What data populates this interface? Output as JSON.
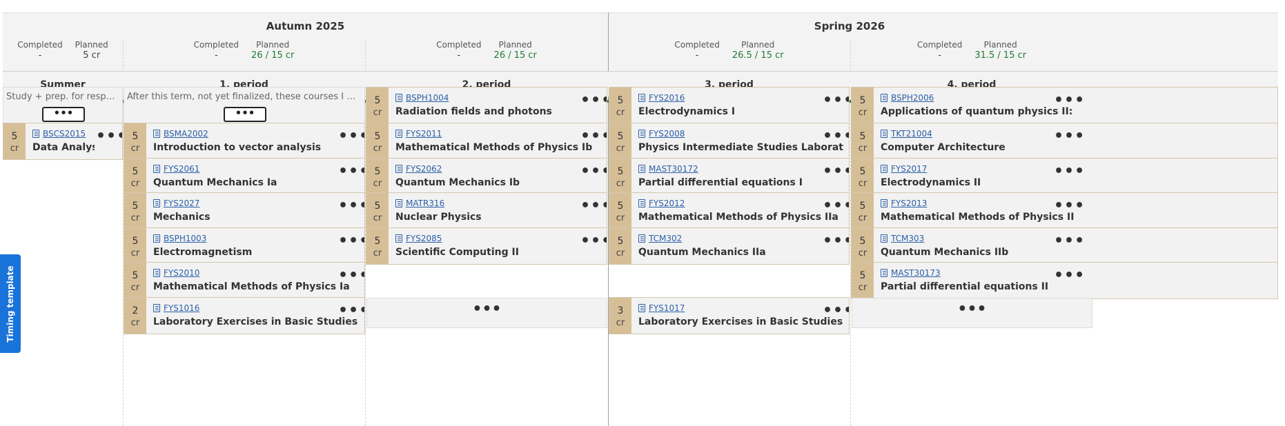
{
  "terms": {
    "autumn": {
      "title": "Autumn 2025"
    },
    "spring": {
      "title": "Spring 2026"
    }
  },
  "stats_labels": {
    "completed": "Completed",
    "planned": "Planned"
  },
  "periods": {
    "summer": {
      "title": "Summer",
      "completed": "-",
      "planned": "5 cr"
    },
    "p1": {
      "title": "1. period",
      "completed": "-",
      "planned": "26 / 15 cr"
    },
    "p2": {
      "title": "2. period",
      "completed": "-",
      "planned": "26 / 15 cr"
    },
    "p3": {
      "title": "3. period",
      "completed": "-",
      "planned": "26.5 / 15 cr"
    },
    "p4": {
      "title": "4. period",
      "completed": "-",
      "planned": "31.5 / 15 cr"
    }
  },
  "notes": {
    "summer": "Study + prep. for respective e...",
    "p1": "After this term, not yet finalized, these courses I would really lik...",
    "menu_label": "•••"
  },
  "credit_unit": "cr",
  "menu_label": "•••",
  "courses": {
    "summer": [
      {
        "credits": "5",
        "code": "BSCS2015",
        "name": "Data Analysis wit"
      }
    ],
    "p1": [
      {
        "credits": "5",
        "code": "BSMA2002",
        "name": "Introduction to vector analysis"
      },
      {
        "credits": "5",
        "code": "FYS2061",
        "name": "Quantum Mechanics Ia"
      },
      {
        "credits": "5",
        "code": "FYS2027",
        "name": "Mechanics"
      },
      {
        "credits": "5",
        "code": "BSPH1003",
        "name": "Electromagnetism"
      },
      {
        "credits": "5",
        "code": "FYS2010",
        "name": "Mathematical Methods of Physics Ia"
      },
      {
        "credits": "2",
        "code": "FYS1016",
        "name": "Laboratory Exercises in Basic Studies of Physics I"
      }
    ],
    "p2": [
      {
        "credits": "5",
        "code": "BSPH1004",
        "name": "Radiation fields and photons"
      },
      {
        "credits": "5",
        "code": "FYS2011",
        "name": "Mathematical Methods of Physics Ib"
      },
      {
        "credits": "5",
        "code": "FYS2062",
        "name": "Quantum Mechanics Ib"
      },
      {
        "credits": "5",
        "code": "MATR316",
        "name": "Nuclear Physics"
      },
      {
        "credits": "5",
        "code": "FYS2085",
        "name": "Scientific Computing II"
      }
    ],
    "p3": [
      {
        "credits": "5",
        "code": "FYS2016",
        "name": "Electrodynamics I"
      },
      {
        "credits": "5",
        "code": "FYS2008",
        "name": "Physics Intermediate Studies Laboratory Exercises"
      },
      {
        "credits": "5",
        "code": "MAST30172",
        "name": "Partial differential equations I"
      },
      {
        "credits": "5",
        "code": "FYS2012",
        "name": "Mathematical Methods of Physics IIa"
      },
      {
        "credits": "5",
        "code": "TCM302",
        "name": "Quantum Mechanics IIa"
      },
      {
        "credits": "3",
        "code": "FYS1017",
        "name": "Laboratory Exercises in Basic Studies of Physics II"
      }
    ],
    "p4": [
      {
        "credits": "5",
        "code": "BSPH2006",
        "name": "Applications of quantum physics II: solid state and"
      },
      {
        "credits": "5",
        "code": "TKT21004",
        "name": "Computer Architecture"
      },
      {
        "credits": "5",
        "code": "FYS2017",
        "name": "Electrodynamics II"
      },
      {
        "credits": "5",
        "code": "FYS2013",
        "name": "Mathematical Methods of Physics IIb"
      },
      {
        "credits": "5",
        "code": "TCM303",
        "name": "Quantum Mechanics IIb"
      },
      {
        "credits": "5",
        "code": "MAST30173",
        "name": "Partial differential equations II"
      }
    ]
  },
  "timing_template": {
    "label": "Timing template"
  },
  "colors": {
    "accent_green": "#217a3b",
    "credit_tan": "#d6bf97",
    "link_blue": "#2a5fa8",
    "tab_blue": "#1a73d9"
  }
}
